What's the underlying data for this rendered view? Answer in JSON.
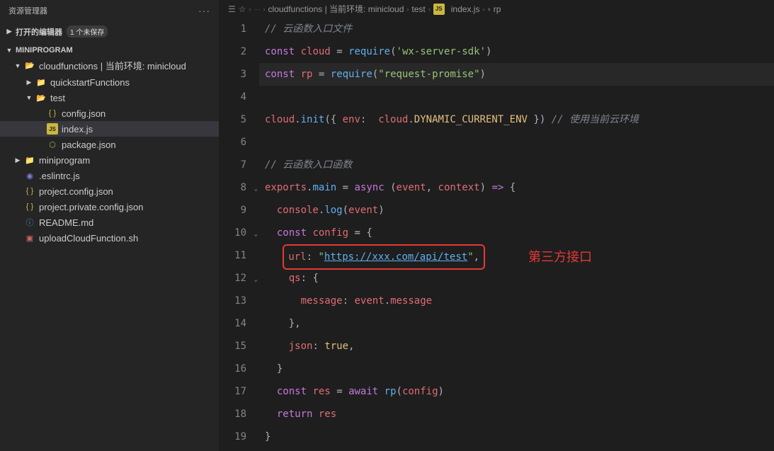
{
  "sidebar": {
    "title": "资源管理器",
    "sections": {
      "open_editors": {
        "label": "打开的编辑器",
        "badge": "1 个未保存"
      },
      "project": {
        "label": "MINIPROGRAM"
      }
    },
    "tree": [
      {
        "id": "cloudfunctions",
        "label": "cloudfunctions | 当前环境: minicloud",
        "type": "folder-open",
        "depth": 1,
        "expanded": true
      },
      {
        "id": "quickstart",
        "label": "quickstartFunctions",
        "type": "folder",
        "depth": 2,
        "expanded": false
      },
      {
        "id": "test",
        "label": "test",
        "type": "folder-open",
        "depth": 2,
        "expanded": true
      },
      {
        "id": "config-json",
        "label": "config.json",
        "type": "json",
        "depth": 3
      },
      {
        "id": "index-js",
        "label": "index.js",
        "type": "js",
        "depth": 3,
        "selected": true
      },
      {
        "id": "package-json",
        "label": "package.json",
        "type": "json-green",
        "depth": 3
      },
      {
        "id": "miniprogram",
        "label": "miniprogram",
        "type": "folder",
        "depth": 1,
        "expanded": false
      },
      {
        "id": "eslintrc",
        "label": ".eslintrc.js",
        "type": "eslint",
        "depth": 1
      },
      {
        "id": "project-config",
        "label": "project.config.json",
        "type": "json",
        "depth": 1
      },
      {
        "id": "project-private",
        "label": "project.private.config.json",
        "type": "json",
        "depth": 1
      },
      {
        "id": "readme",
        "label": "README.md",
        "type": "info",
        "depth": 1
      },
      {
        "id": "upload-sh",
        "label": "uploadCloudFunction.sh",
        "type": "sh",
        "depth": 1
      }
    ]
  },
  "breadcrumb": {
    "items": [
      "cloudfunctions | 当前环境: minicloud",
      "test",
      "index.js",
      "rp"
    ],
    "icons": [
      "",
      "",
      "js",
      "sq"
    ]
  },
  "editor": {
    "lines": [
      {
        "n": 1,
        "html": "<span class='comment'>// 云函数入口文件</span>"
      },
      {
        "n": 2,
        "html": "<span class='kw'>const</span> <span class='var'>cloud</span> <span class='op'>=</span> <span class='fn'>require</span><span class='op'>(</span><span class='str'>'wx-server-sdk'</span><span class='op'>)</span>"
      },
      {
        "n": 3,
        "html": "<span class='kw'>const</span> <span class='var'>rp</span> <span class='op'>=</span> <span class='fn'>require</span><span class='op'>(</span><span class='str'>\"request-promise\"</span><span class='op'>)</span>",
        "cursor": true
      },
      {
        "n": 4,
        "html": ""
      },
      {
        "n": 5,
        "html": "<span class='var'>cloud</span><span class='op'>.</span><span class='fn'>init</span><span class='op'>({</span> <span class='prop'>env</span><span class='op'>:</span>  <span class='var'>cloud</span><span class='op'>.</span><span class='const'>DYNAMIC_CURRENT_ENV</span> <span class='op'>})</span> <span class='comment'>// 使用当前云环境</span>"
      },
      {
        "n": 6,
        "html": ""
      },
      {
        "n": 7,
        "html": "<span class='comment'>// 云函数入口函数</span>"
      },
      {
        "n": 8,
        "html": "<span class='var'>exports</span><span class='op'>.</span><span class='fn'>main</span> <span class='op'>=</span> <span class='kw'>async</span> <span class='op'>(</span><span class='var'>event</span><span class='op'>,</span> <span class='var'>context</span><span class='op'>)</span> <span class='kw'>=&gt;</span> <span class='op'>{</span>",
        "fold": true
      },
      {
        "n": 9,
        "html": "  <span class='var'>console</span><span class='op'>.</span><span class='fn'>log</span><span class='op'>(</span><span class='var'>event</span><span class='op'>)</span>"
      },
      {
        "n": 10,
        "html": "  <span class='kw'>const</span> <span class='var'>config</span> <span class='op'>=</span> <span class='op'>{</span>",
        "fold": true
      },
      {
        "n": 11,
        "html": "   <span class='red-box'><span class='prop'>url</span><span class='op'>:</span> <span class='str'>\"<span class='link'>https://xxx.com/api/test</span>\"</span><span class='op'>,</span></span>"
      },
      {
        "n": 12,
        "html": "    <span class='prop'>qs</span><span class='op'>:</span> <span class='op'>{</span>",
        "fold": true
      },
      {
        "n": 13,
        "html": "      <span class='prop'>message</span><span class='op'>:</span> <span class='var'>event</span><span class='op'>.</span><span class='var'>message</span>"
      },
      {
        "n": 14,
        "html": "    <span class='op'>},</span>"
      },
      {
        "n": 15,
        "html": "    <span class='prop'>json</span><span class='op'>:</span> <span class='const'>true</span><span class='op'>,</span>"
      },
      {
        "n": 16,
        "html": "  <span class='op'>}</span>"
      },
      {
        "n": 17,
        "html": "  <span class='kw'>const</span> <span class='var'>res</span> <span class='op'>=</span> <span class='kw'>await</span> <span class='fn'>rp</span><span class='op'>(</span><span class='var'>config</span><span class='op'>)</span>"
      },
      {
        "n": 18,
        "html": "  <span class='kw'>return</span> <span class='var'>res</span>"
      },
      {
        "n": 19,
        "html": "<span class='op'>}</span>"
      }
    ]
  },
  "annotation": {
    "label": "第三方接口",
    "line": 11
  }
}
